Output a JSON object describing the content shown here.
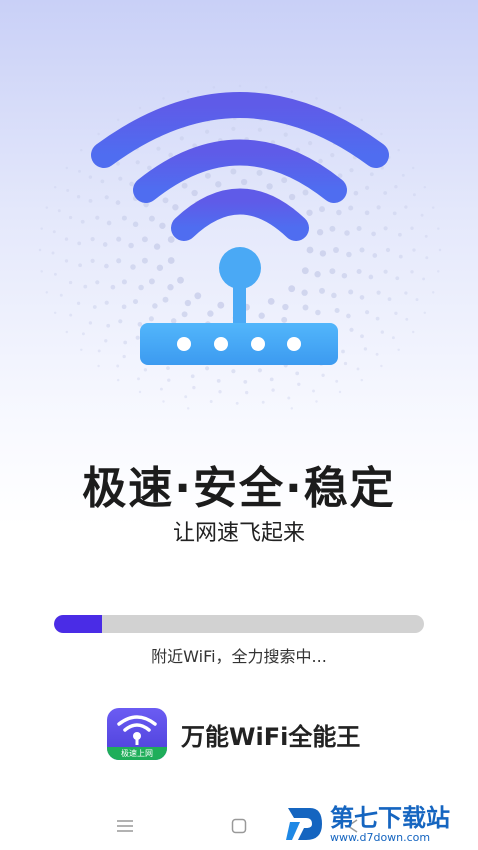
{
  "hero": {
    "illustration": "wifi-router-illustration"
  },
  "headline": "极速·安全·稳定",
  "subtitle": "让网速飞起来",
  "progress": {
    "fraction": 0.13
  },
  "status_text": "附近WiFi，全力搜索中...",
  "brand": {
    "icon_tag": "极速上网",
    "name": "万能WiFi全能王"
  },
  "navbar": {
    "icons": [
      "menu-icon",
      "home-icon",
      "back-icon"
    ]
  },
  "watermark": {
    "title": "第七下载站",
    "url": "www.d7down.com"
  },
  "colors": {
    "accent": "#4a2ce6",
    "wifi_arc": "#5b63e8",
    "router": "#4aa9f5",
    "progress_track": "#d2d2d2"
  }
}
